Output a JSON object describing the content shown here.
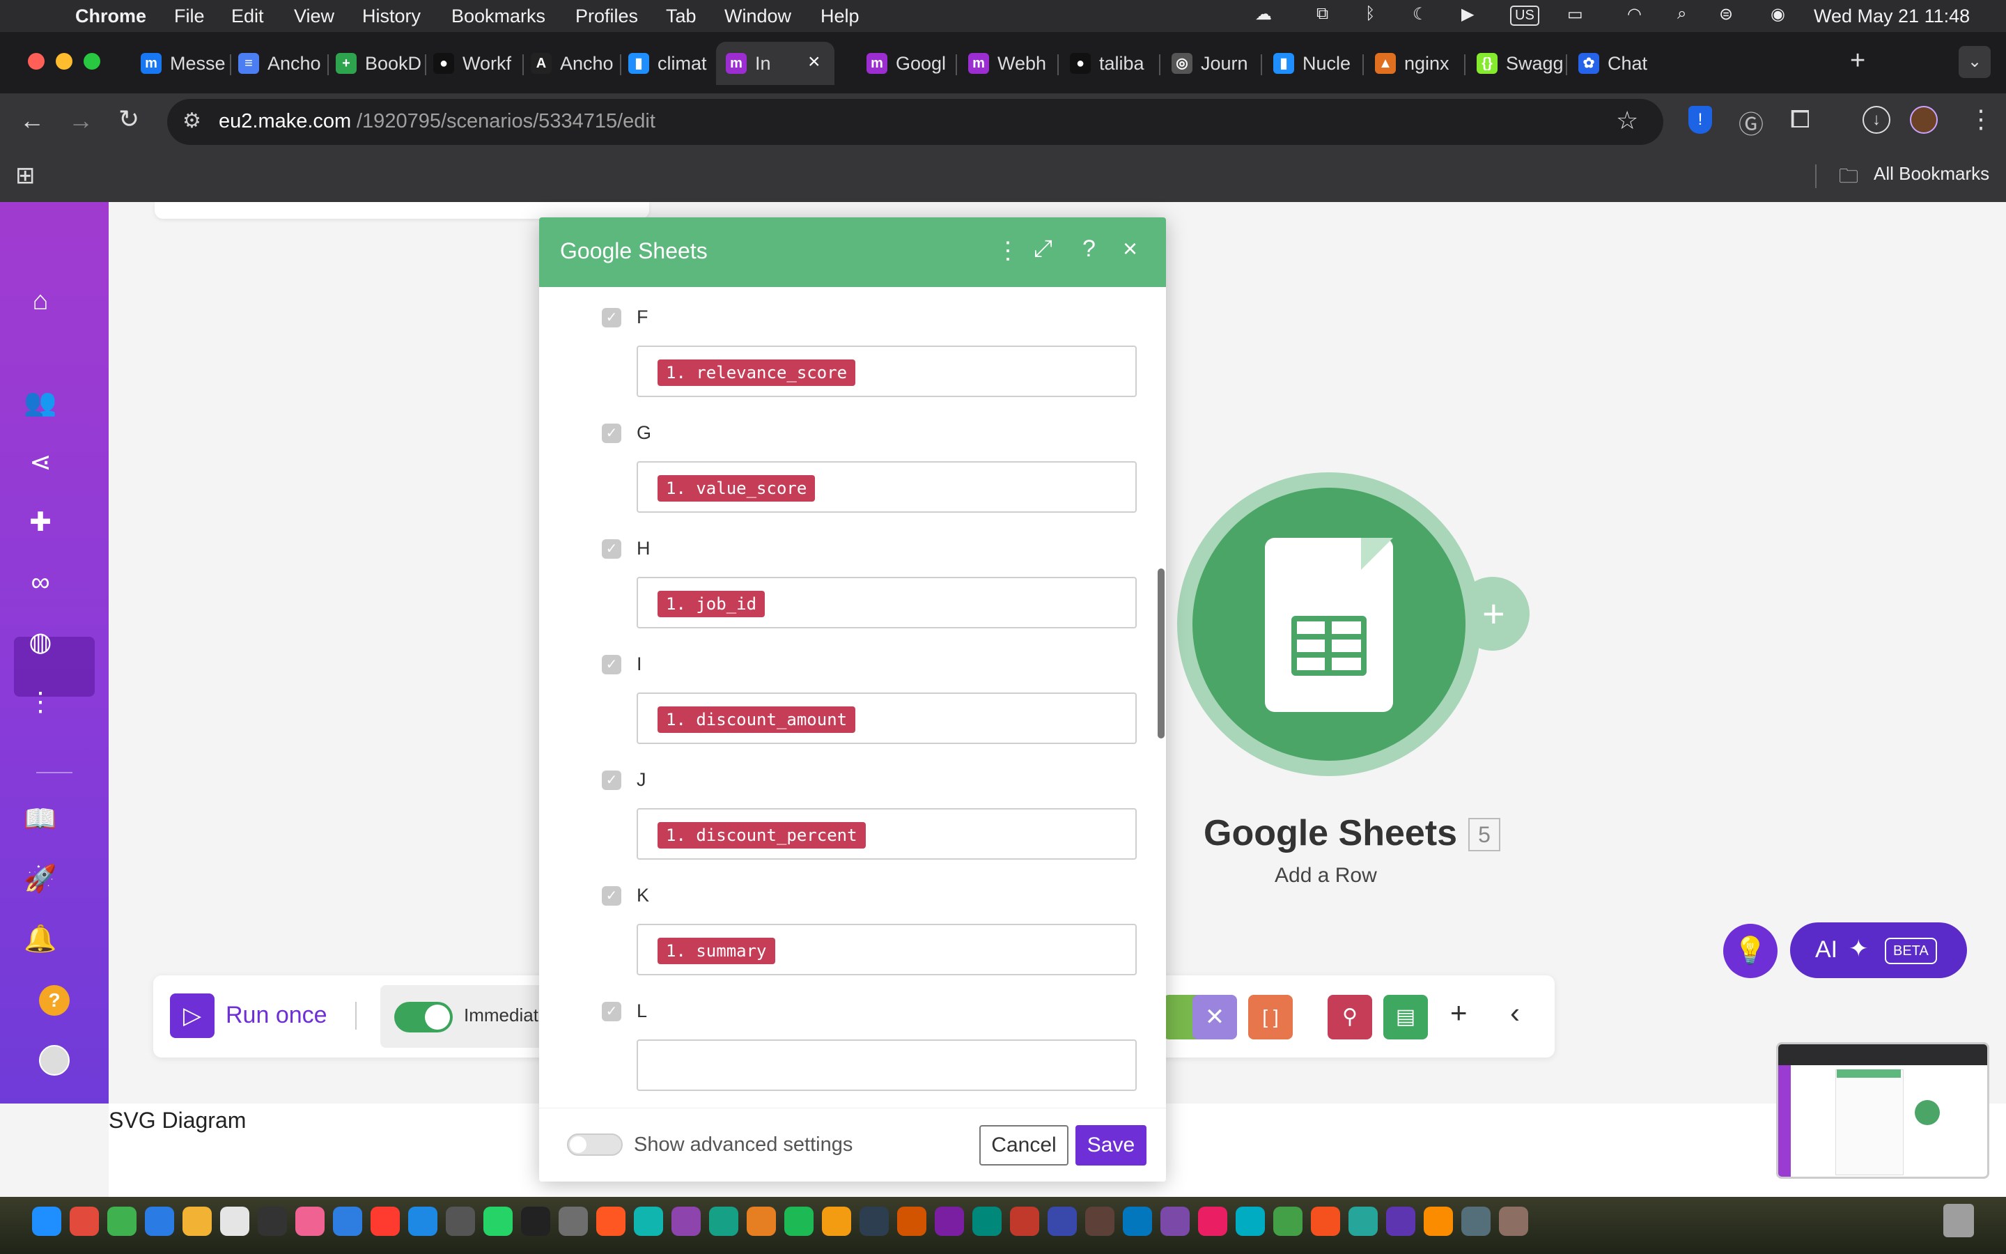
{
  "menubar": {
    "app": "Chrome",
    "items": [
      "File",
      "Edit",
      "View",
      "History",
      "Bookmarks",
      "Profiles",
      "Tab",
      "Window",
      "Help"
    ],
    "input_source": "US",
    "datetime": "Wed May 21  11:48"
  },
  "tabs": [
    {
      "title": "Messe",
      "color": "#1877f2",
      "glyph": "m"
    },
    {
      "title": "Ancho",
      "color": "#4c7ef3",
      "glyph": "≡"
    },
    {
      "title": "BookD",
      "color": "#2ea44f",
      "glyph": "+"
    },
    {
      "title": "Workf",
      "color": "#111",
      "glyph": "●"
    },
    {
      "title": "Ancho",
      "color": "#222",
      "glyph": "A"
    },
    {
      "title": "climat",
      "color": "#1f8fff",
      "glyph": "▮"
    },
    {
      "title": "In",
      "color": "#9b2dd1",
      "glyph": "m"
    },
    {
      "title": "Googl",
      "color": "#9b2dd1",
      "glyph": "m"
    },
    {
      "title": "Webh",
      "color": "#9b2dd1",
      "glyph": "m"
    },
    {
      "title": "taliba",
      "color": "#111",
      "glyph": "●"
    },
    {
      "title": "Journ",
      "color": "#555",
      "glyph": "◎"
    },
    {
      "title": "Nucle",
      "color": "#1f8fff",
      "glyph": "▮"
    },
    {
      "title": "nginx",
      "color": "#e07020",
      "glyph": "▲"
    },
    {
      "title": "Swagg",
      "color": "#85ea2d",
      "glyph": "{}"
    },
    {
      "title": "Chat",
      "color": "#2563eb",
      "glyph": "✿"
    }
  ],
  "url": {
    "host": "eu2.make.com",
    "path": "/1920795/scenarios/5334715/edit"
  },
  "bookmarks": {
    "all_label": "All Bookmarks"
  },
  "modal": {
    "title": "Google Sheets",
    "rows": [
      {
        "col": "F",
        "value": "1. relevance_score"
      },
      {
        "col": "G",
        "value": "1. value_score"
      },
      {
        "col": "H",
        "value": "1. job_id"
      },
      {
        "col": "I",
        "value": "1. discount_amount"
      },
      {
        "col": "J",
        "value": "1. discount_percent"
      },
      {
        "col": "K",
        "value": "1. summary"
      },
      {
        "col": "L",
        "value": ""
      }
    ],
    "advanced_label": "Show advanced settings",
    "cancel_label": "Cancel",
    "save_label": "Save"
  },
  "module": {
    "title": "Google Sheets",
    "badge": "5",
    "subtitle": "Add a Row"
  },
  "bottombar": {
    "run_once": "Run once",
    "schedule": "Immediate"
  },
  "ai": {
    "label": "AI",
    "badge": "BETA"
  },
  "footer_label": "SVG Diagram",
  "colors": {
    "make_purple": "#6e2fd6",
    "sheets_green": "#5cb87c",
    "pill_red": "#c63d57"
  }
}
